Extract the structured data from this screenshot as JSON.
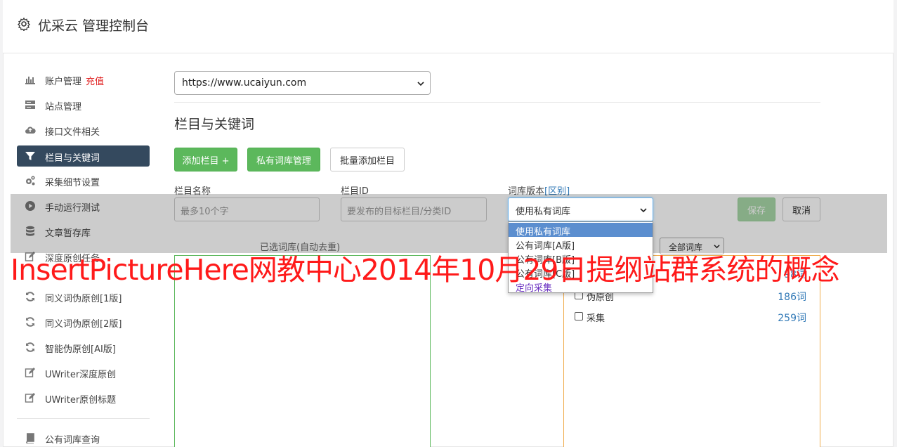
{
  "header": {
    "title": "优采云 管理控制台",
    "icon": "gear-icon"
  },
  "sidebar": {
    "items": [
      {
        "label": "账户管理",
        "extra": "充值",
        "icon": "bar-chart-icon"
      },
      {
        "label": "站点管理",
        "icon": "server-icon"
      },
      {
        "label": "接口文件相关",
        "icon": "cloud-upload-icon"
      },
      {
        "label": "栏目与关键词",
        "icon": "filter-icon",
        "active": true
      },
      {
        "label": "采集细节设置",
        "icon": "cogs-icon"
      },
      {
        "label": "手动运行测试",
        "icon": "play-circle-icon"
      },
      {
        "label": "文章暂存库",
        "icon": "database-icon"
      },
      {
        "label": "深度原创任务",
        "icon": "edit-icon"
      },
      {
        "label": "同义词伪原创[1版]",
        "icon": "refresh-icon"
      },
      {
        "label": "同义词伪原创[2版]",
        "icon": "refresh-icon"
      },
      {
        "label": "智能伪原创[AI版]",
        "icon": "refresh-icon"
      },
      {
        "label": "UWriter深度原创",
        "icon": "edit-icon"
      },
      {
        "label": "UWriter原创标题",
        "icon": "edit-icon"
      },
      {
        "label": "公有词库查询",
        "icon": "book-icon"
      }
    ]
  },
  "site_select": {
    "value": "https://www.ucaiyun.com"
  },
  "section": {
    "title": "栏目与关键词"
  },
  "toolbar": {
    "add_column": "添加栏目 +",
    "private_lib": "私有词库管理",
    "batch_add": "批量添加栏目"
  },
  "form": {
    "name_label": "栏目名称",
    "name_placeholder": "最多10个字",
    "id_label": "栏目ID",
    "id_placeholder": "要发布的目标栏目/分类ID",
    "version_label": "词库版本",
    "version_link": "[区别]",
    "version_value": "使用私有词库",
    "save": "保存",
    "cancel": "取消"
  },
  "dropdown": {
    "options": [
      "使用私有词库",
      "公有词库[A版]",
      "公有词库[B版]",
      "公有词库[C版]",
      "定向采集"
    ]
  },
  "selected_list": {
    "label": "已选词库(自动去重)"
  },
  "filter": {
    "value": "全部词库"
  },
  "libraries": [
    {
      "name": "",
      "count": "98词"
    },
    {
      "name": "伪原创",
      "count": "186词"
    },
    {
      "name": "采集",
      "count": "259词"
    }
  ],
  "banner": {
    "text": "InsertPictureHere网教中心2014年10月29日提纲站群系统的概念"
  },
  "colors": {
    "primary_green": "#5cb85c",
    "active_nav": "#34495e",
    "recharge_red": "#e02020",
    "banner_red": "#ff1a1a"
  }
}
